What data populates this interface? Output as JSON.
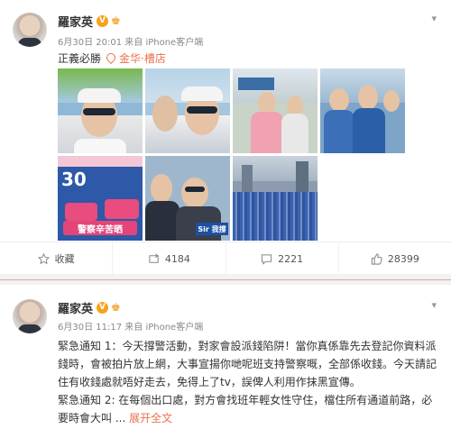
{
  "post1": {
    "author": "羅家英",
    "verified_badge": "V",
    "crown_icon": "crown-icon",
    "timestamp": "6月30日 20:01",
    "source": "来自 iPhone客户端",
    "text": "正義必勝",
    "location": "金华·槽店",
    "photos": [
      {
        "name": "selfie-1"
      },
      {
        "name": "selfie-2"
      },
      {
        "name": "group-photo"
      },
      {
        "name": "group-photo-2"
      },
      {
        "name": "rally-banner",
        "banner_text": "警察辛苦晒",
        "banner_top": "30"
      },
      {
        "name": "selfie-3",
        "sign_text": "Sir 我撐"
      },
      {
        "name": "aerial-rally"
      }
    ],
    "actions": {
      "favorite": "收藏",
      "repost": "4184",
      "comment": "2221",
      "like": "28399"
    }
  },
  "post2": {
    "author": "羅家英",
    "verified_badge": "V",
    "timestamp": "6月30日 11:17",
    "source": "来自 iPhone客户端",
    "paragraph1": "緊急通知 1：今天撐警活動，對家會設派錢陷阱！當你真係靠先去登記你資料派錢時，會被拍片放上網，大事宣揚你哋呢班支持警察嘅，全部係收錢。今天請記住有收錢處就唔好走去，免得上了tv，誤俾人利用作抹黑宣傳。",
    "paragraph2_start": "緊急通知 2: 在每個出口處，對方會找班年輕女性守住，檔住所有通道前路，必要時會大叫 ...",
    "expand_label": "展开全文"
  },
  "colors": {
    "accent": "#eb7350",
    "badge": "#f7a21a"
  }
}
